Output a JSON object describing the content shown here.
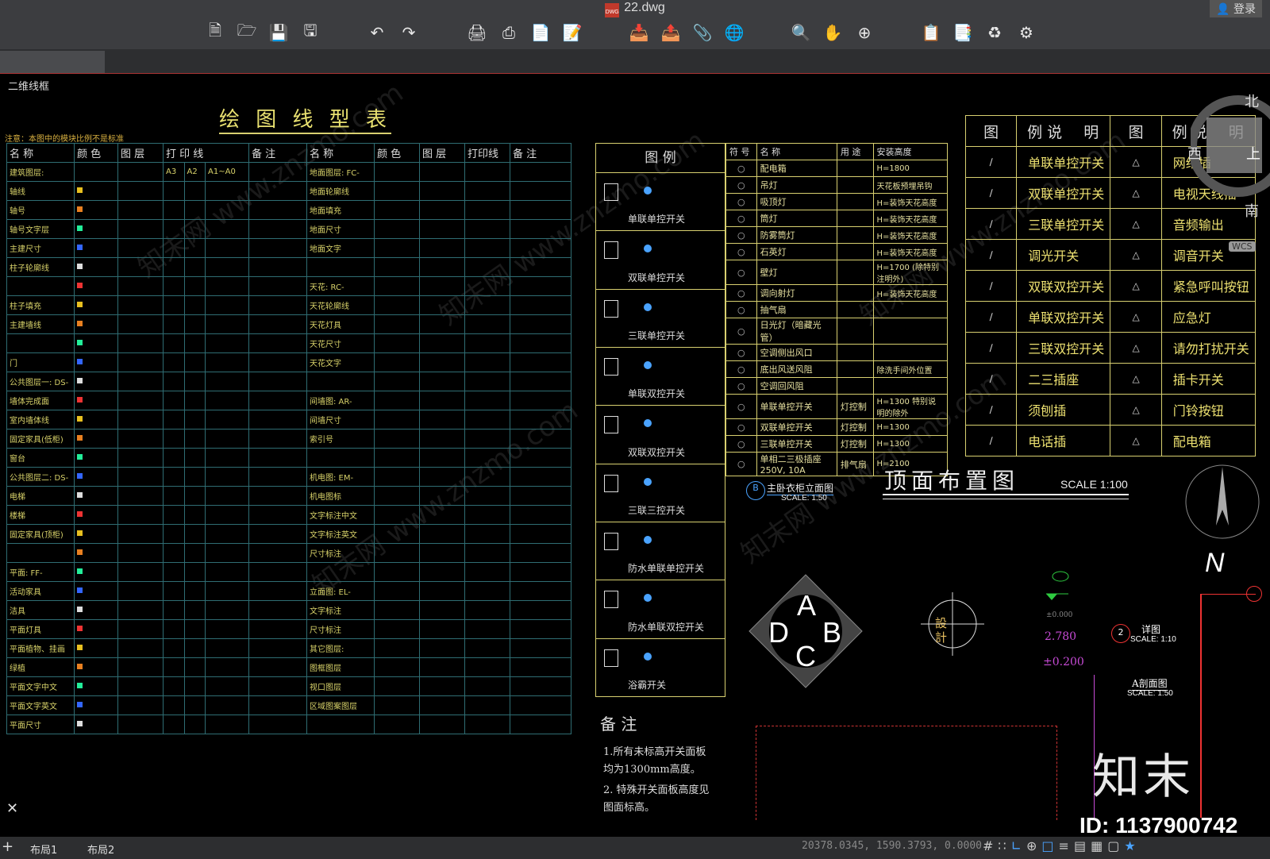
{
  "window": {
    "title": "22.dwg",
    "login": "登录",
    "file_badge": "DWG"
  },
  "toolbar": {
    "icons": [
      "new-icon",
      "open-icon",
      "save-icon",
      "save-as-icon",
      "undo-icon",
      "redo-icon",
      "print-icon",
      "plot-icon",
      "publish-icon",
      "export-pdf-icon",
      "import-icon",
      "export-icon",
      "attach-icon",
      "share-icon",
      "zoom-icon",
      "pan-icon",
      "orbit-icon",
      "layer-icon",
      "properties-icon",
      "blocks-icon",
      "render-icon"
    ]
  },
  "viewport": {
    "label": "二维线框"
  },
  "left_table": {
    "title": "绘 图 线 型 表",
    "note": "注意：本图中的模块比例不是标准",
    "headers": [
      "名  称",
      "颜 色",
      "图 层",
      "打 印 线",
      "备 注",
      "名  称",
      "颜 色",
      "图 层",
      "打印线",
      "备 注"
    ],
    "print_sub": [
      "A3",
      "A2",
      "A1~A0"
    ],
    "left_rows": [
      "建筑图层:",
      "轴线",
      "轴号",
      "轴号文字层",
      "主建尺寸",
      "柱子轮廓线",
      "",
      "柱子填充",
      "主建墙线",
      "",
      "门",
      "公共图层一: DS-",
      "墙体完成面",
      "室内墙体线",
      "固定家具(低柜)",
      "窗台",
      "公共图层二: DS-",
      "电梯",
      "楼梯",
      "固定家具(顶柜)",
      "",
      "平面: FF-",
      "活动家具",
      "洁具",
      "平面灯具",
      "平面植物、挂画",
      "绿植",
      "平面文字中文",
      "平面文字英文",
      "平面尺寸"
    ],
    "right_rows": [
      "地面图层: FC-",
      "地面轮廓线",
      "地面填充",
      "地面尺寸",
      "地面文字",
      "",
      "天花: RC-",
      "天花轮廓线",
      "天花灯具",
      "天花尺寸",
      "天花文字",
      "",
      "间墙图: AR-",
      "间墙尺寸",
      "索引号",
      "",
      "机电图: EM-",
      "机电图标",
      "文字标注中文",
      "文字标注英文",
      "尺寸标注",
      "",
      "立面图: EL-",
      "文字标注",
      "尺寸标注",
      "其它图层:",
      "图框图层",
      "视口图层",
      "区域图案图层",
      ""
    ]
  },
  "legend_panel": {
    "header": "图    例",
    "items": [
      "单联单控开关",
      "双联单控开关",
      "三联单控开关",
      "单联双控开关",
      "双联双控开关",
      "三联三控开关",
      "防水单联单控开关",
      "防水单联双控开关",
      "浴霸开关"
    ],
    "notes_title": "备 注",
    "notes": [
      "1.所有未标高开关面板",
      "均为1300mm高度。",
      "2. 特殊开关面板高度见",
      "图面标高。"
    ]
  },
  "symbol_table": {
    "headers": [
      "符 号",
      "名  称",
      "用 途",
      "安装高度"
    ],
    "rows": [
      [
        "配电箱",
        "",
        "H=1800"
      ],
      [
        "吊灯",
        "",
        "天花板预埋吊钩"
      ],
      [
        "吸顶灯",
        "",
        "H=装饰天花高度"
      ],
      [
        "筒灯",
        "",
        "H=装饰天花高度"
      ],
      [
        "防雾筒灯",
        "",
        "H=装饰天花高度"
      ],
      [
        "石英灯",
        "",
        "H=装饰天花高度"
      ],
      [
        "壁灯",
        "",
        "H=1700 (除特别注明外)"
      ],
      [
        "调向射灯",
        "",
        "H=装饰天花高度"
      ],
      [
        "抽气扇",
        "",
        ""
      ],
      [
        "日光灯（暗藏光管）",
        "",
        ""
      ],
      [
        "空调侧出风口",
        "",
        ""
      ],
      [
        "底出风送风阻",
        "",
        "除洗手间外位置"
      ],
      [
        "空调回风阻",
        "",
        ""
      ],
      [
        "单联单控开关",
        "灯控制",
        "H=1300 特别说明的除外"
      ],
      [
        "双联单控开关",
        "灯控制",
        "H=1300"
      ],
      [
        "三联单控开关",
        "灯控制",
        "H=1300"
      ],
      [
        "单相二三极插座 250V, 10A",
        "排气扇",
        "H=2100"
      ]
    ]
  },
  "right_legend": {
    "headers": [
      "图",
      "例 说",
      "明",
      "图",
      "例 说",
      "明"
    ],
    "left_items": [
      "单联单控开关",
      "双联单控开关",
      "三联单控开关",
      "调光开关",
      "双联双控开关",
      "单联双控开关",
      "三联双控开关",
      "二三插座",
      "须刨插",
      "电话插"
    ],
    "right_items": [
      "网络插",
      "电视天线插",
      "音频输出",
      "调音开关",
      "紧急呼叫按钮",
      "应急灯",
      "请勿打扰开关",
      "插卡开关",
      "门铃按钮",
      "配电箱"
    ]
  },
  "drawing": {
    "plan_title": "顶面布置图",
    "plan_scale": "SCALE 1:100",
    "elev_title": "主卧衣柜立面图",
    "elev_scale": "SCALE: 1:50",
    "elev_tag": "B",
    "detail_title": "详图",
    "detail_scale": "SCALE: 1:10",
    "detail_num": "2",
    "section_title": "A剖面图",
    "section_scale": "SCALE: 1:50",
    "diamond_letters": [
      "A",
      "B",
      "C",
      "D"
    ],
    "level1": "2.780",
    "level2": "±0.200",
    "level0": "±0.000",
    "north": "N",
    "design_stamp": "設 計"
  },
  "viewcube": {
    "north": "北",
    "south": "南",
    "west": "西",
    "top": "上",
    "wcs": "WCS"
  },
  "status": {
    "layouts": [
      "布局1",
      "布局2"
    ],
    "coordinates": "20378.0345, 1590.3793, 0.0000",
    "plus": "+"
  },
  "watermark": {
    "id": "ID: 1137900742",
    "logo": "知末",
    "text": "知末网 www.znzmo.com"
  }
}
